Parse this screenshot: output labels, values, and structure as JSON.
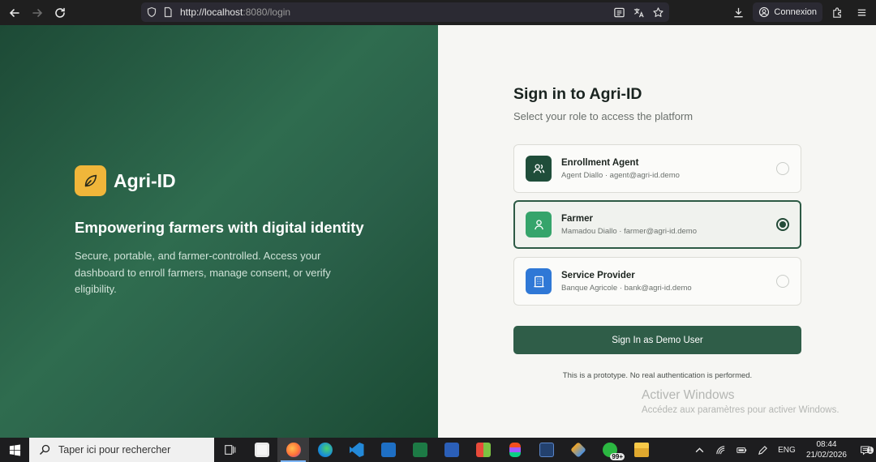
{
  "browser": {
    "url_host": "http://localhost",
    "url_path": ":8080/login",
    "account_label": "Connexion"
  },
  "hero": {
    "brand": "Agri-ID",
    "title": "Empowering farmers with digital identity",
    "description": "Secure, portable, and farmer-controlled. Access your dashboard to enroll farmers, manage consent, or verify eligibility."
  },
  "form": {
    "title": "Sign in to Agri-ID",
    "subtitle": "Select your role to access the platform",
    "roles": [
      {
        "name": "Enrollment Agent",
        "meta": "Agent Diallo · agent@agri-id.demo",
        "icon": "users-icon",
        "color": "#1f4d3a",
        "selected": false
      },
      {
        "name": "Farmer",
        "meta": "Mamadou Diallo · farmer@agri-id.demo",
        "icon": "user-icon",
        "color": "#35a46b",
        "selected": true
      },
      {
        "name": "Service Provider",
        "meta": "Banque Agricole · bank@agri-id.demo",
        "icon": "building-icon",
        "color": "#2f78d6",
        "selected": false
      }
    ],
    "submit_label": "Sign In as Demo User",
    "disclaimer": "This is a prototype. No real authentication is performed."
  },
  "watermark": {
    "title": "Activer Windows",
    "subtitle": "Accédez aux paramètres pour activer Windows."
  },
  "taskbar": {
    "search_placeholder": "Taper ici pour rechercher",
    "whatsapp_badge": "99+",
    "language": "ENG",
    "time": "08:44",
    "date": "21/02/2026",
    "notification_count": "1"
  },
  "colors": {
    "brand_green": "#2f5d48",
    "logo_yellow": "#f0b63a"
  }
}
